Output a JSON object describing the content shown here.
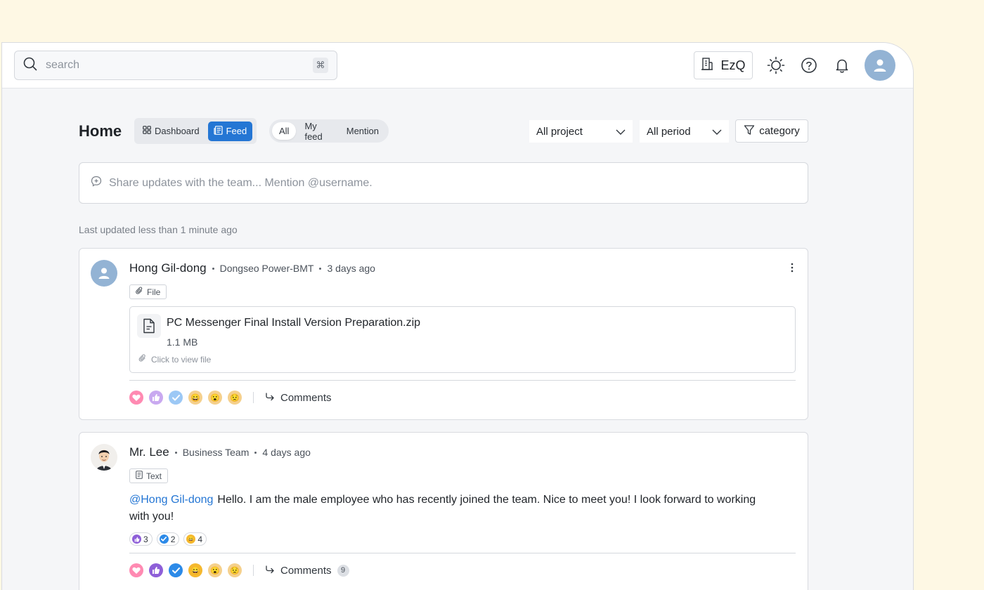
{
  "topbar": {
    "search_placeholder": "search",
    "shortcut_glyph": "⌘",
    "org_name": "EzQ",
    "icons": [
      "search-icon",
      "building-icon",
      "sun-icon",
      "help-icon",
      "bell-icon",
      "user-avatar"
    ]
  },
  "header": {
    "title": "Home",
    "view_tabs": [
      {
        "label": "Dashboard",
        "icon": "grid-icon",
        "active": false
      },
      {
        "label": "Feed",
        "icon": "feed-icon",
        "active": true
      }
    ],
    "filter_tabs": [
      {
        "label": "All",
        "active": true
      },
      {
        "label": "My feed",
        "active": false
      },
      {
        "label": "Mention",
        "active": false
      }
    ],
    "project_select": "All project",
    "period_select": "All period",
    "category_label": "category"
  },
  "composer": {
    "placeholder": "Share updates with the team... Mention @username."
  },
  "last_updated": "Last updated less than 1 minute ago",
  "posts": [
    {
      "author": "Hong Gil-dong",
      "team": "Dongseo Power-BMT",
      "time": "3 days ago",
      "type": "File",
      "file": {
        "name": "PC Messenger Final Install Version Preparation.zip",
        "size": "1.1 MB",
        "hint": "Click to view file"
      },
      "comments_label": "Comments"
    },
    {
      "author": "Mr. Lee",
      "team": "Business Team",
      "time": "4 days ago",
      "type": "Text",
      "mention": "@Hong Gil-dong",
      "text": "Hello. I am the male employee who has recently joined the team. Nice to meet you! I look forward to working with you!",
      "reaction_counts": [
        {
          "emoji": "thumbs-up",
          "count": "3"
        },
        {
          "emoji": "check",
          "count": "2"
        },
        {
          "emoji": "grin",
          "count": "4"
        }
      ],
      "comments_label": "Comments",
      "comments_count": "9"
    }
  ],
  "colors": {
    "accent": "#2476d4",
    "page_bg": "#fef8e4",
    "window_bg": "#f5f6f8",
    "avatar_bg": "#93b3d4"
  }
}
